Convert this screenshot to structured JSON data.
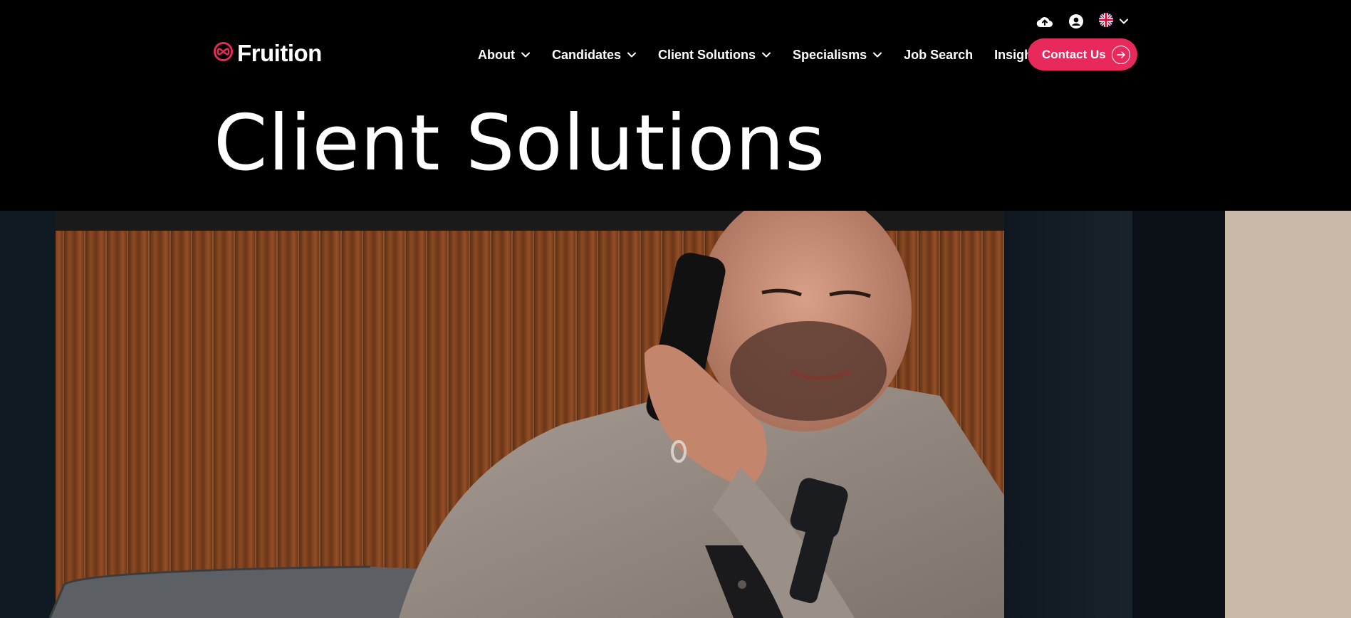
{
  "header": {
    "logo_text": "Fruition",
    "nav_items": [
      {
        "label": "About",
        "has_dropdown": true
      },
      {
        "label": "Candidates",
        "has_dropdown": true
      },
      {
        "label": "Client Solutions",
        "has_dropdown": true
      },
      {
        "label": "Specialisms",
        "has_dropdown": true
      },
      {
        "label": "Job Search",
        "has_dropdown": false
      },
      {
        "label": "Insights",
        "has_dropdown": true
      }
    ],
    "contact_label": "Contact Us",
    "utility_icons": [
      "cloud-upload-icon",
      "user-account-icon",
      "uk-flag-icon"
    ]
  },
  "page": {
    "title": "Client Solutions"
  },
  "colors": {
    "background": "#000000",
    "accent": "#e8295c",
    "text": "#ffffff"
  }
}
